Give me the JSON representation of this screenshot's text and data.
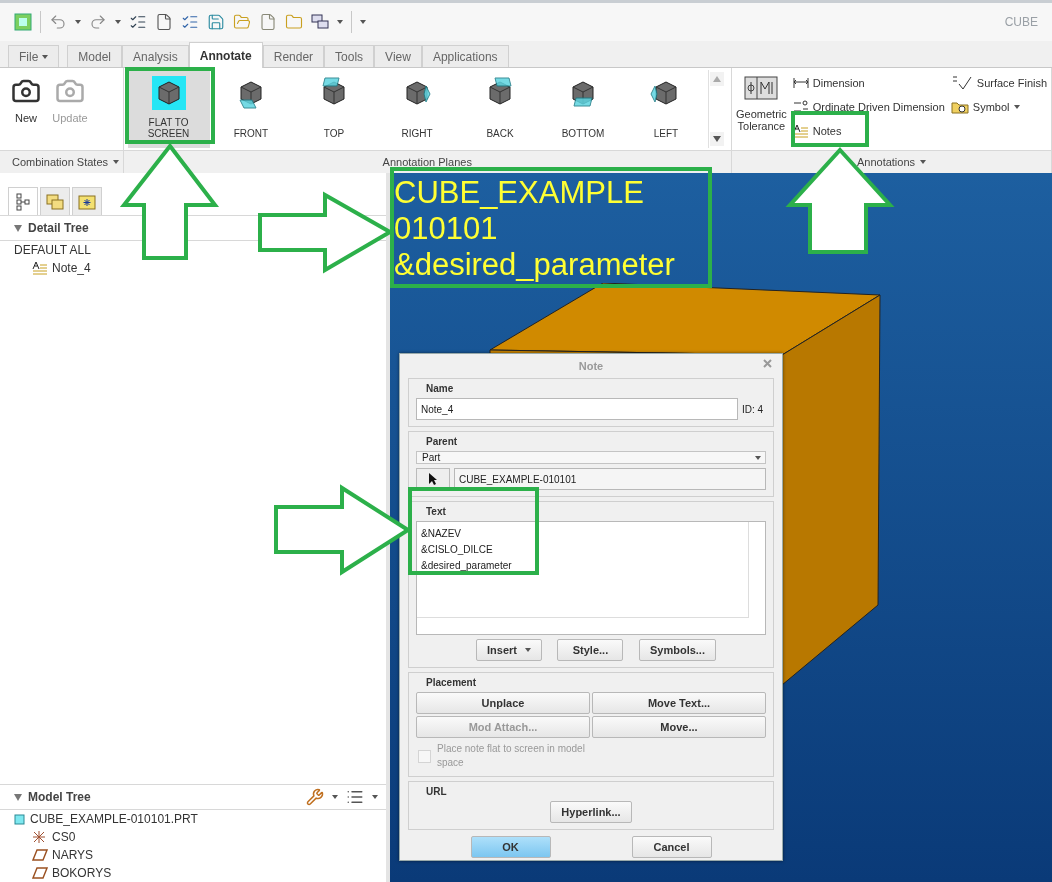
{
  "window": {
    "title": "CUBE"
  },
  "tabs": [
    {
      "label": "File",
      "kind": "menu",
      "selected": false
    },
    {
      "label": "Model",
      "kind": "tab",
      "selected": false
    },
    {
      "label": "Analysis",
      "kind": "tab",
      "selected": false
    },
    {
      "label": "Annotate",
      "kind": "tab",
      "selected": true
    },
    {
      "label": "Render",
      "kind": "tab",
      "selected": false
    },
    {
      "label": "Tools",
      "kind": "tab",
      "selected": false
    },
    {
      "label": "View",
      "kind": "tab",
      "selected": false
    },
    {
      "label": "Applications",
      "kind": "tab",
      "selected": false
    }
  ],
  "ribbon": {
    "combination_states": {
      "label": "Combination States",
      "menu": true,
      "items": [
        {
          "label": "New",
          "disabled": false
        },
        {
          "label": "Update",
          "disabled": true
        }
      ]
    },
    "annotation_planes": {
      "label": "Annotation Planes",
      "menu": false,
      "items": [
        {
          "label": "FLAT  TO SCREEN",
          "selected": true
        },
        {
          "label": "FRONT",
          "selected": false
        },
        {
          "label": "TOP",
          "selected": false
        },
        {
          "label": "RIGHT",
          "selected": false
        },
        {
          "label": "BACK",
          "selected": false
        },
        {
          "label": "BOTTOM",
          "selected": false
        },
        {
          "label": "LEFT",
          "selected": false
        }
      ]
    },
    "annotations": {
      "label": "Annotations",
      "menu": true,
      "large": {
        "label": "Geometric Tolerance"
      },
      "columns": [
        [
          {
            "label": "Dimension",
            "kind": "dimension"
          },
          {
            "label": "Ordinate Driven Dimension",
            "kind": "ordinate"
          },
          {
            "label": "Notes",
            "kind": "notes"
          }
        ],
        [
          {
            "label": "Surface Finish",
            "kind": "finish"
          },
          {
            "label": "Symbol",
            "kind": "symbol",
            "dropdown": true
          }
        ]
      ]
    }
  },
  "detail_tree": {
    "title": "Detail Tree",
    "items": [
      {
        "label": "DEFAULT ALL",
        "children": [
          {
            "label": "Note_4",
            "kind": "note"
          }
        ]
      }
    ]
  },
  "model_tree": {
    "title": "Model Tree",
    "items": [
      {
        "label": "CUBE_EXAMPLE-010101.PRT",
        "kind": "part",
        "children": [
          {
            "label": "CS0",
            "kind": "csys"
          },
          {
            "label": "NARYS",
            "kind": "plane"
          },
          {
            "label": "BOKORYS",
            "kind": "plane"
          }
        ]
      }
    ]
  },
  "viewport": {
    "note_lines": [
      "CUBE_EXAMPLE",
      "010101",
      "&desired_parameter"
    ]
  },
  "dialog": {
    "title": "Note",
    "name": {
      "label": "Name",
      "value": "Note_4",
      "id": "ID: 4"
    },
    "parent": {
      "label": "Parent",
      "type": "Part",
      "reference": "CUBE_EXAMPLE-010101"
    },
    "text": {
      "label": "Text",
      "lines": [
        "&NAZEV",
        "&CISLO_DILCE",
        "&desired_parameter"
      ]
    },
    "text_buttons": [
      {
        "label": "Insert",
        "dropdown": true
      },
      {
        "label": "Style...",
        "dropdown": false
      },
      {
        "label": "Symbols...",
        "dropdown": false
      }
    ],
    "placement": {
      "label": "Placement",
      "buttons": [
        {
          "label": "Unplace",
          "disabled": false
        },
        {
          "label": "Move Text...",
          "disabled": false
        },
        {
          "label": "Mod Attach...",
          "disabled": true
        },
        {
          "label": "Move...",
          "disabled": false
        }
      ],
      "checkbox": {
        "label": "Place note flat to screen in model space",
        "checked": false,
        "disabled": true
      }
    },
    "url": {
      "label": "URL",
      "button": "Hyperlink..."
    },
    "buttons": [
      {
        "label": "OK",
        "kind": "primary"
      },
      {
        "label": "Cancel",
        "kind": "normal"
      }
    ]
  }
}
